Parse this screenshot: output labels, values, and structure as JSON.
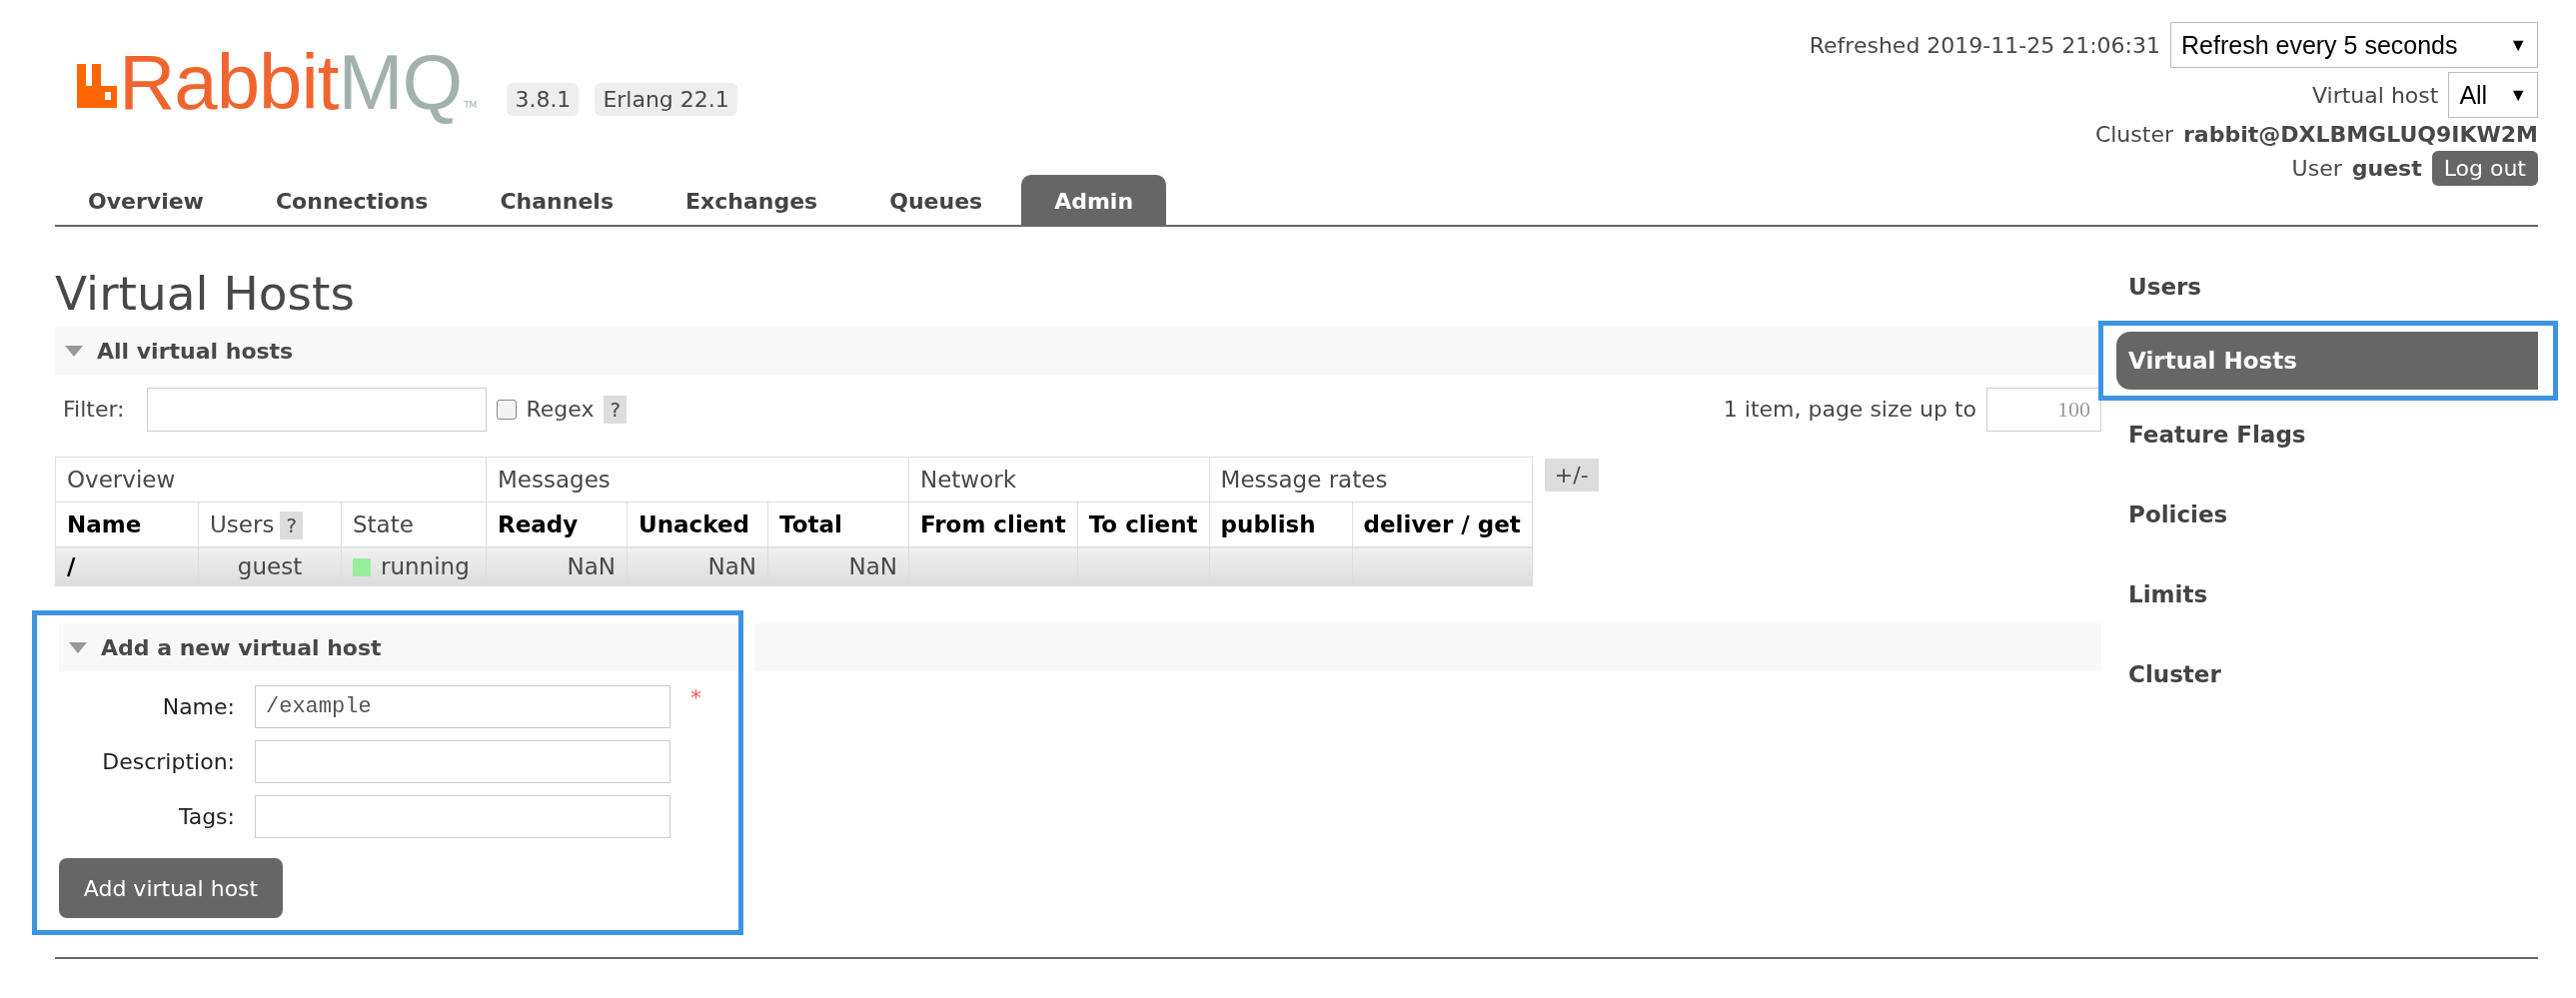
{
  "logo": {
    "primary": "Rabbit",
    "secondary": "MQ",
    "mark": "TM"
  },
  "badges": [
    "3.8.1",
    "Erlang 22.1"
  ],
  "header": {
    "refreshed": "Refreshed 2019-11-25 21:06:31",
    "refresh_select": {
      "value": "Refresh every 5 seconds",
      "caret": "▼"
    },
    "vhost_label": "Virtual host",
    "vhost_select": {
      "value": "All",
      "caret": "▼"
    },
    "cluster_label": "Cluster",
    "cluster_name": "rabbit@DXLBMGLUQ9IKW2M",
    "user_label": "User",
    "user_name": "guest",
    "logout": "Log out"
  },
  "tabs": [
    {
      "label": "Overview",
      "selected": false
    },
    {
      "label": "Connections",
      "selected": false
    },
    {
      "label": "Channels",
      "selected": false
    },
    {
      "label": "Exchanges",
      "selected": false
    },
    {
      "label": "Queues",
      "selected": false
    },
    {
      "label": "Admin",
      "selected": true
    }
  ],
  "page_title": "Virtual Hosts",
  "list_section": {
    "title": "All virtual hosts",
    "expanded": true,
    "filter_label": "Filter:",
    "regex_label": "Regex",
    "regex_checked": false,
    "help": "?",
    "paging_text": "1 item, page size up to",
    "page_size": "100",
    "table": {
      "groups": [
        {
          "label": "Overview",
          "columns": [
            {
              "label": "Name",
              "bold": true
            },
            {
              "label": "Users",
              "bold": false,
              "help": "?"
            },
            {
              "label": "State",
              "bold": false
            }
          ]
        },
        {
          "label": "Messages",
          "columns": [
            {
              "label": "Ready",
              "bold": true
            },
            {
              "label": "Unacked",
              "bold": true
            },
            {
              "label": "Total",
              "bold": true
            }
          ]
        },
        {
          "label": "Network",
          "columns": [
            {
              "label": "From client",
              "bold": true
            },
            {
              "label": "To client",
              "bold": true
            }
          ]
        },
        {
          "label": "Message rates",
          "columns": [
            {
              "label": "publish",
              "bold": true
            },
            {
              "label": "deliver / get",
              "bold": true
            }
          ]
        }
      ],
      "rows": [
        {
          "name": "/",
          "users": "guest",
          "state": "running",
          "ready": "NaN",
          "unacked": "NaN",
          "total": "NaN"
        }
      ],
      "toggle": "+/-"
    }
  },
  "add_section": {
    "title": "Add a new virtual host",
    "expanded": true,
    "highlighted": true,
    "required_mark": "*",
    "fields": [
      {
        "label": "Name:",
        "value": "/example",
        "required": true
      },
      {
        "label": "Description:",
        "required": false
      },
      {
        "label": "Tags:",
        "required": false
      }
    ],
    "submit": "Add virtual host"
  },
  "sidebar": {
    "items": [
      {
        "label": "Users",
        "selected": false,
        "highlighted": false
      },
      {
        "label": "Virtual Hosts",
        "selected": true,
        "highlighted": true
      },
      {
        "label": "Feature Flags",
        "selected": false,
        "highlighted": false
      },
      {
        "label": "Policies",
        "selected": false,
        "highlighted": false
      },
      {
        "label": "Limits",
        "selected": false,
        "highlighted": false
      },
      {
        "label": "Cluster",
        "selected": false,
        "highlighted": false
      }
    ]
  }
}
